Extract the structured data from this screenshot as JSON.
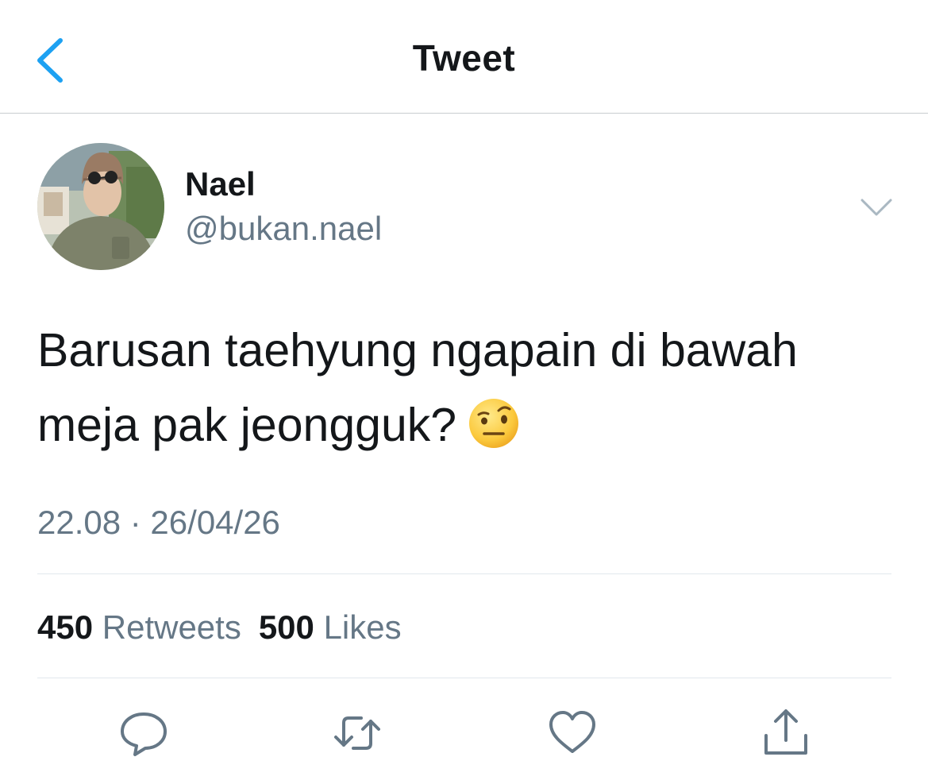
{
  "header": {
    "title": "Tweet"
  },
  "author": {
    "display_name": "Nael",
    "handle": "@bukan.nael"
  },
  "tweet": {
    "text_line1": "Barusan taehyung ngapain di bawah",
    "text_line2": "meja pak jeongguk?",
    "emoji": "face-with-raised-eyebrow-emoji",
    "timestamp": "22.08 · 26/04/26"
  },
  "stats": {
    "retweets_count": "450",
    "retweets_label": "Retweets",
    "likes_count": "500",
    "likes_label": "Likes"
  },
  "actions": [
    "reply-icon",
    "retweet-icon",
    "like-icon",
    "share-icon"
  ],
  "colors": {
    "accent": "#1da1f2",
    "secondary_text": "#657786",
    "divider": "#e1e8ed",
    "icon": "#657786"
  }
}
